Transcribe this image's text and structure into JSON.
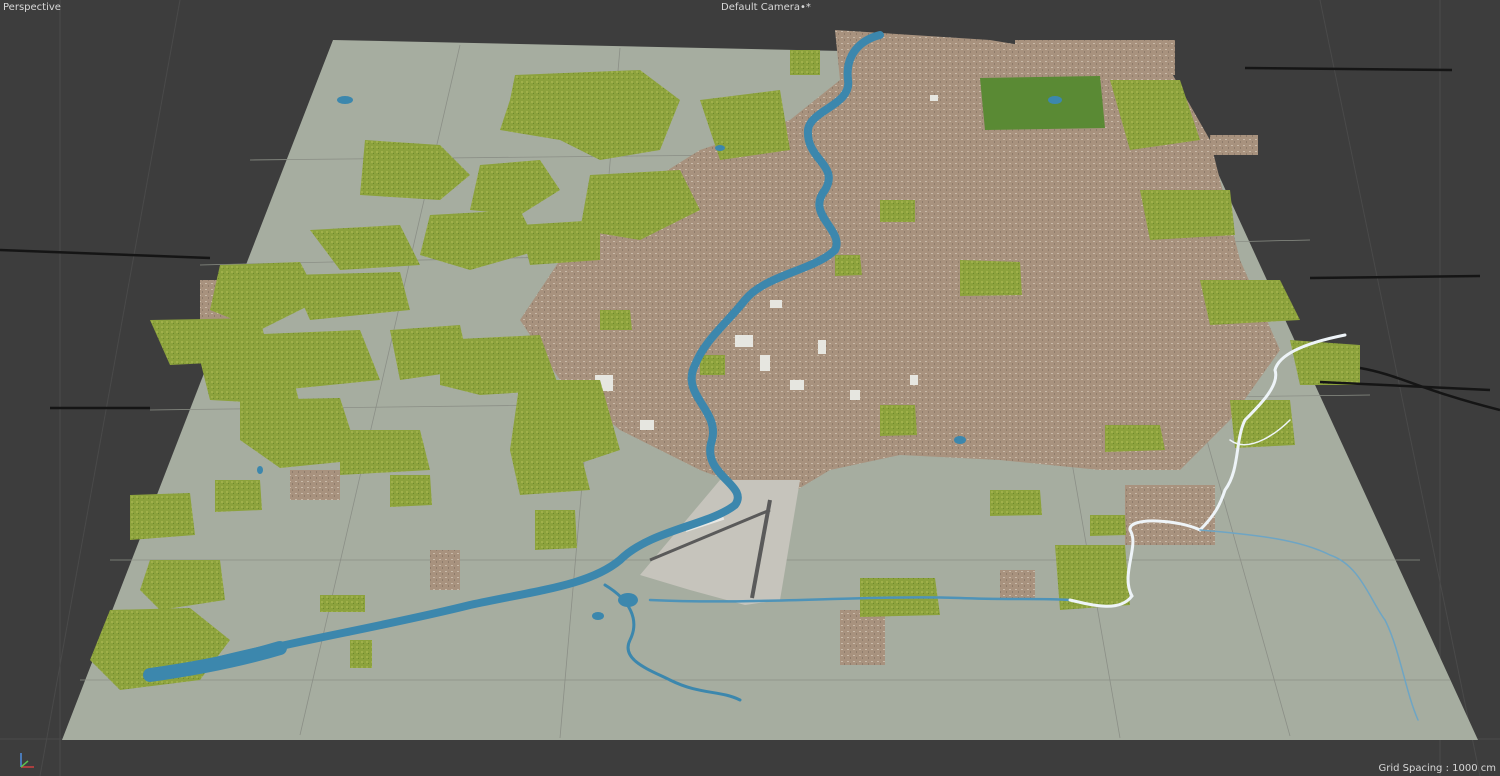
{
  "viewport": {
    "view_mode": "Perspective",
    "camera": "Default Camera",
    "camera_suffix": "•*",
    "grid_spacing": "Grid Spacing : 1000 cm"
  },
  "colors": {
    "background": "#3d3d3d",
    "ground_plane": "#a6ada0",
    "urban": "#a99480",
    "vegetation": "#8aa23a",
    "forest": "#5c8530",
    "water": "#3c87ad",
    "river_highlight": "#eef4f8",
    "airport": "#c6c4bc",
    "road": "#8b8f86"
  },
  "icons": [
    "axis-gizmo-icon"
  ]
}
